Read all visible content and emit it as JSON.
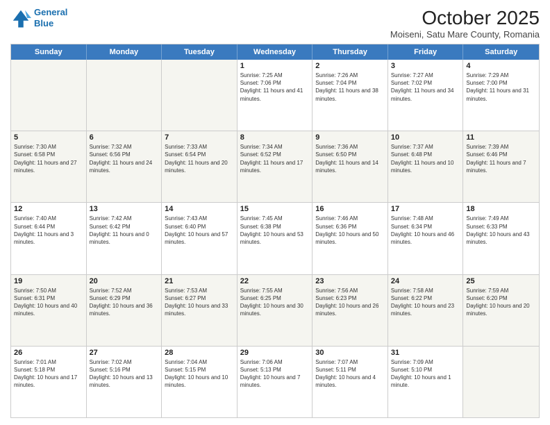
{
  "header": {
    "logo_line1": "General",
    "logo_line2": "Blue",
    "title": "October 2025",
    "subtitle": "Moiseni, Satu Mare County, Romania"
  },
  "days_of_week": [
    "Sunday",
    "Monday",
    "Tuesday",
    "Wednesday",
    "Thursday",
    "Friday",
    "Saturday"
  ],
  "weeks": [
    [
      {
        "day": "",
        "info": ""
      },
      {
        "day": "",
        "info": ""
      },
      {
        "day": "",
        "info": ""
      },
      {
        "day": "1",
        "info": "Sunrise: 7:25 AM\nSunset: 7:06 PM\nDaylight: 11 hours and 41 minutes."
      },
      {
        "day": "2",
        "info": "Sunrise: 7:26 AM\nSunset: 7:04 PM\nDaylight: 11 hours and 38 minutes."
      },
      {
        "day": "3",
        "info": "Sunrise: 7:27 AM\nSunset: 7:02 PM\nDaylight: 11 hours and 34 minutes."
      },
      {
        "day": "4",
        "info": "Sunrise: 7:29 AM\nSunset: 7:00 PM\nDaylight: 11 hours and 31 minutes."
      }
    ],
    [
      {
        "day": "5",
        "info": "Sunrise: 7:30 AM\nSunset: 6:58 PM\nDaylight: 11 hours and 27 minutes."
      },
      {
        "day": "6",
        "info": "Sunrise: 7:32 AM\nSunset: 6:56 PM\nDaylight: 11 hours and 24 minutes."
      },
      {
        "day": "7",
        "info": "Sunrise: 7:33 AM\nSunset: 6:54 PM\nDaylight: 11 hours and 20 minutes."
      },
      {
        "day": "8",
        "info": "Sunrise: 7:34 AM\nSunset: 6:52 PM\nDaylight: 11 hours and 17 minutes."
      },
      {
        "day": "9",
        "info": "Sunrise: 7:36 AM\nSunset: 6:50 PM\nDaylight: 11 hours and 14 minutes."
      },
      {
        "day": "10",
        "info": "Sunrise: 7:37 AM\nSunset: 6:48 PM\nDaylight: 11 hours and 10 minutes."
      },
      {
        "day": "11",
        "info": "Sunrise: 7:39 AM\nSunset: 6:46 PM\nDaylight: 11 hours and 7 minutes."
      }
    ],
    [
      {
        "day": "12",
        "info": "Sunrise: 7:40 AM\nSunset: 6:44 PM\nDaylight: 11 hours and 3 minutes."
      },
      {
        "day": "13",
        "info": "Sunrise: 7:42 AM\nSunset: 6:42 PM\nDaylight: 11 hours and 0 minutes."
      },
      {
        "day": "14",
        "info": "Sunrise: 7:43 AM\nSunset: 6:40 PM\nDaylight: 10 hours and 57 minutes."
      },
      {
        "day": "15",
        "info": "Sunrise: 7:45 AM\nSunset: 6:38 PM\nDaylight: 10 hours and 53 minutes."
      },
      {
        "day": "16",
        "info": "Sunrise: 7:46 AM\nSunset: 6:36 PM\nDaylight: 10 hours and 50 minutes."
      },
      {
        "day": "17",
        "info": "Sunrise: 7:48 AM\nSunset: 6:34 PM\nDaylight: 10 hours and 46 minutes."
      },
      {
        "day": "18",
        "info": "Sunrise: 7:49 AM\nSunset: 6:33 PM\nDaylight: 10 hours and 43 minutes."
      }
    ],
    [
      {
        "day": "19",
        "info": "Sunrise: 7:50 AM\nSunset: 6:31 PM\nDaylight: 10 hours and 40 minutes."
      },
      {
        "day": "20",
        "info": "Sunrise: 7:52 AM\nSunset: 6:29 PM\nDaylight: 10 hours and 36 minutes."
      },
      {
        "day": "21",
        "info": "Sunrise: 7:53 AM\nSunset: 6:27 PM\nDaylight: 10 hours and 33 minutes."
      },
      {
        "day": "22",
        "info": "Sunrise: 7:55 AM\nSunset: 6:25 PM\nDaylight: 10 hours and 30 minutes."
      },
      {
        "day": "23",
        "info": "Sunrise: 7:56 AM\nSunset: 6:23 PM\nDaylight: 10 hours and 26 minutes."
      },
      {
        "day": "24",
        "info": "Sunrise: 7:58 AM\nSunset: 6:22 PM\nDaylight: 10 hours and 23 minutes."
      },
      {
        "day": "25",
        "info": "Sunrise: 7:59 AM\nSunset: 6:20 PM\nDaylight: 10 hours and 20 minutes."
      }
    ],
    [
      {
        "day": "26",
        "info": "Sunrise: 7:01 AM\nSunset: 5:18 PM\nDaylight: 10 hours and 17 minutes."
      },
      {
        "day": "27",
        "info": "Sunrise: 7:02 AM\nSunset: 5:16 PM\nDaylight: 10 hours and 13 minutes."
      },
      {
        "day": "28",
        "info": "Sunrise: 7:04 AM\nSunset: 5:15 PM\nDaylight: 10 hours and 10 minutes."
      },
      {
        "day": "29",
        "info": "Sunrise: 7:06 AM\nSunset: 5:13 PM\nDaylight: 10 hours and 7 minutes."
      },
      {
        "day": "30",
        "info": "Sunrise: 7:07 AM\nSunset: 5:11 PM\nDaylight: 10 hours and 4 minutes."
      },
      {
        "day": "31",
        "info": "Sunrise: 7:09 AM\nSunset: 5:10 PM\nDaylight: 10 hours and 1 minute."
      },
      {
        "day": "",
        "info": ""
      }
    ]
  ]
}
